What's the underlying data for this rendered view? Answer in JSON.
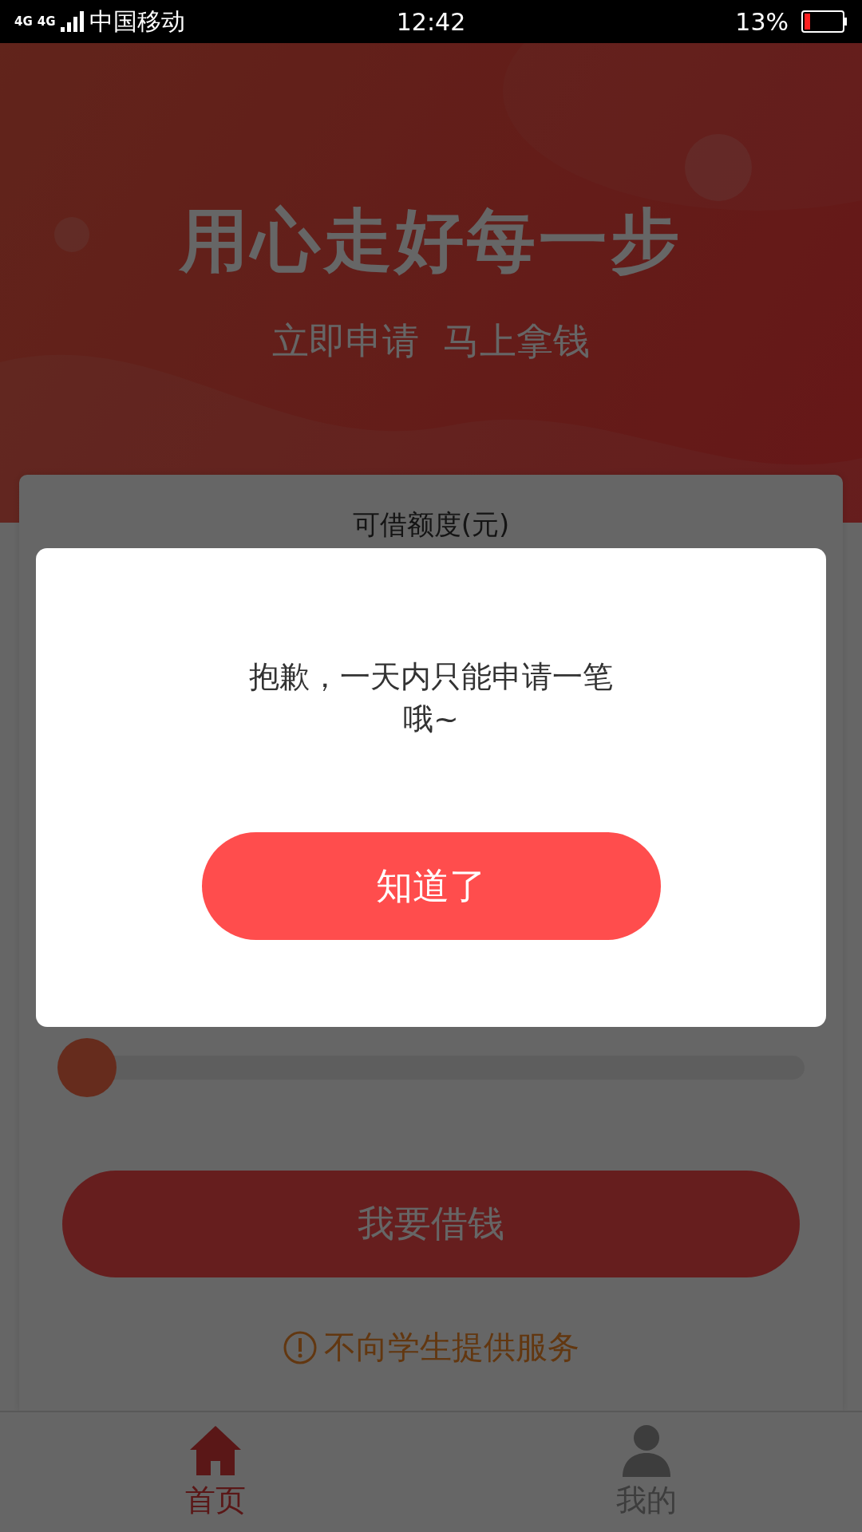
{
  "status_bar": {
    "network": [
      "4G",
      "4G"
    ],
    "carrier": "中国移动",
    "time": "12:42",
    "battery": "13%"
  },
  "banner": {
    "title": "用心走好每一步",
    "subtitle": "立即申请  马上拿钱"
  },
  "card": {
    "title": "可借额度(元)",
    "slider": {
      "level": 0
    },
    "button": "我要借钱",
    "notice": "不向学生提供服务"
  },
  "tab_bar": [
    {
      "label": "首页",
      "kind": "home",
      "selected": true
    },
    {
      "label": "我的",
      "kind": "profile",
      "selected": false
    }
  ],
  "dialog": {
    "message": "抱歉，一天内只能申请一笔哦~",
    "button": "知道了"
  }
}
